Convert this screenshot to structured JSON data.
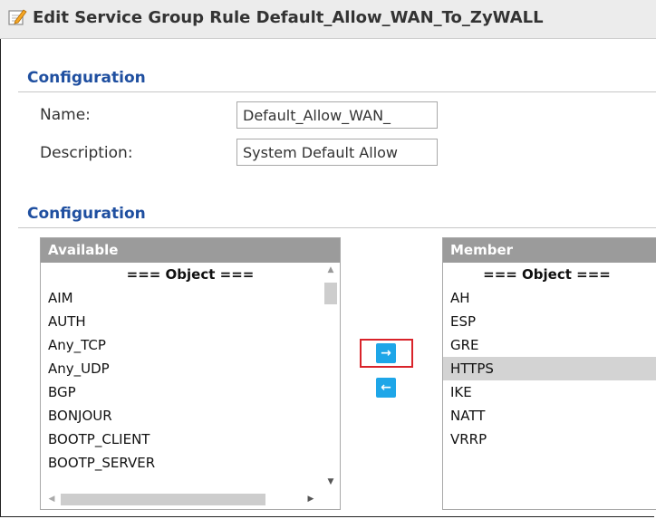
{
  "window": {
    "title": "Edit Service Group Rule Default_Allow_WAN_To_ZyWALL",
    "title_icon": "edit-icon"
  },
  "config_section": {
    "header": "Configuration",
    "name_label": "Name:",
    "name_value": "Default_Allow_WAN_",
    "description_label": "Description:",
    "description_value": "System Default Allow"
  },
  "members_section": {
    "header": "Configuration",
    "available": {
      "header": "Available",
      "items": [
        {
          "label": "=== Object ===",
          "group": true
        },
        {
          "label": "AIM"
        },
        {
          "label": "AUTH"
        },
        {
          "label": "Any_TCP"
        },
        {
          "label": "Any_UDP"
        },
        {
          "label": "BGP"
        },
        {
          "label": "BONJOUR"
        },
        {
          "label": "BOOTP_CLIENT"
        },
        {
          "label": "BOOTP_SERVER"
        }
      ]
    },
    "member": {
      "header": "Member",
      "items": [
        {
          "label": "=== Object ===",
          "group": true
        },
        {
          "label": "AH"
        },
        {
          "label": "ESP"
        },
        {
          "label": "GRE"
        },
        {
          "label": "HTTPS",
          "selected": true
        },
        {
          "label": "IKE"
        },
        {
          "label": "NATT"
        },
        {
          "label": "VRRP"
        }
      ]
    },
    "buttons": {
      "add_icon": "arrow-right-icon",
      "remove_icon": "arrow-left-icon"
    }
  },
  "colors": {
    "section_header": "#1f4fa0",
    "list_header_bg": "#9b9b9b",
    "move_button": "#1ea6e8",
    "highlight": "#d9232a",
    "selected_row": "#d3d3d3"
  }
}
